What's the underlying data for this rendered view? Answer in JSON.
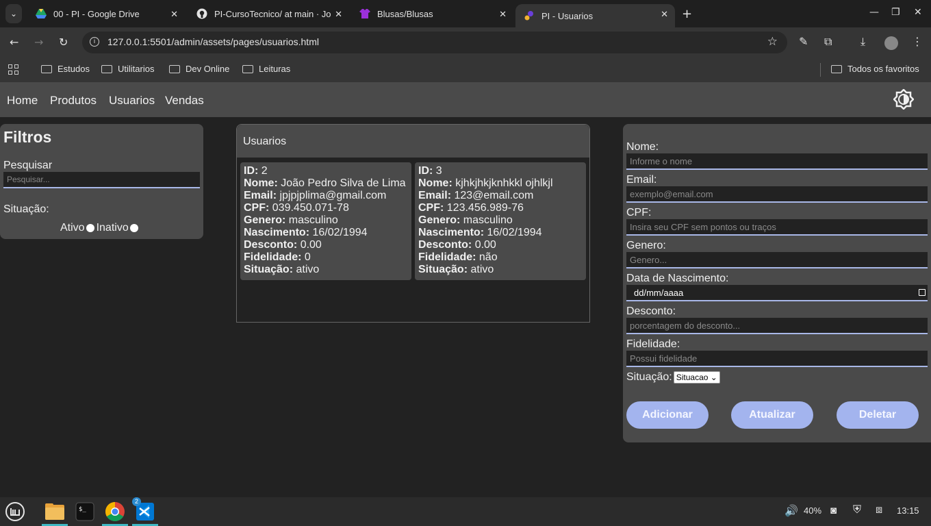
{
  "browser": {
    "tabs": [
      {
        "title": "00 - PI - Google Drive",
        "icon": "google-drive-icon"
      },
      {
        "title": "PI-CursoTecnico/ at main · Jo",
        "icon": "github-icon"
      },
      {
        "title": "Blusas/Blusas",
        "icon": "shirt-icon"
      },
      {
        "title": "PI - Usuarios",
        "icon": "app-favicon",
        "active": true
      }
    ],
    "url": "127.0.0.1:5501/admin/assets/pages/usuarios.html",
    "bookmarks": [
      "Estudos",
      "Utilitarios",
      "Dev Online",
      "Leituras"
    ],
    "all_bookmarks": "Todos os favoritos"
  },
  "nav": {
    "items": [
      "Home",
      "Produtos",
      "Usuarios",
      "Vendas"
    ]
  },
  "filters": {
    "title": "Filtros",
    "search_label": "Pesquisar",
    "search_placeholder": "Pesquisar...",
    "status_label": "Situação:",
    "active_label": "Ativo",
    "inactive_label": "Inativo"
  },
  "users": {
    "header": "Usuarios",
    "labels": {
      "id": "ID:",
      "name": "Nome:",
      "email": "Email:",
      "cpf": "CPF:",
      "gender": "Genero:",
      "birth": "Nascimento:",
      "discount": "Desconto:",
      "loyalty": "Fidelidade:",
      "status": "Situação:"
    },
    "list": [
      {
        "id": "2",
        "name": "João Pedro Silva de Lima",
        "email": "jpjpjplima@gmail.com",
        "cpf": "039.450.071-78",
        "gender": "masculino",
        "birth": "16/02/1994",
        "discount": "0.00",
        "loyalty": "0",
        "status": "ativo"
      },
      {
        "id": "3",
        "name": "kjhkjhkjknhkkl ojhlkjl",
        "email": "123@email.com",
        "cpf": "123.456.989-76",
        "gender": "masculino",
        "birth": "16/02/1994",
        "discount": "0.00",
        "loyalty": "não",
        "status": "ativo"
      }
    ]
  },
  "form": {
    "name_label": "Nome:",
    "name_placeholder": "Informe o nome",
    "email_label": "Email:",
    "email_placeholder": "exemplo@email.com",
    "cpf_label": "CPF:",
    "cpf_placeholder": "Insira seu CPF sem pontos ou traços",
    "gender_label": "Genero:",
    "gender_placeholder": "Genero...",
    "birth_label": "Data de Nascimento:",
    "birth_placeholder": "dd/mm/aaaa",
    "discount_label": "Desconto:",
    "discount_placeholder": "porcentagem do desconto...",
    "loyalty_label": "Fidelidade:",
    "loyalty_placeholder": "Possui fidelidade",
    "status_label": "Situação:",
    "status_selected": "Situacao",
    "buttons": {
      "add": "Adicionar",
      "update": "Atualizar",
      "delete": "Deletar"
    }
  },
  "taskbar": {
    "volume": "40%",
    "time": "13:15",
    "vscode_badge": "2"
  }
}
